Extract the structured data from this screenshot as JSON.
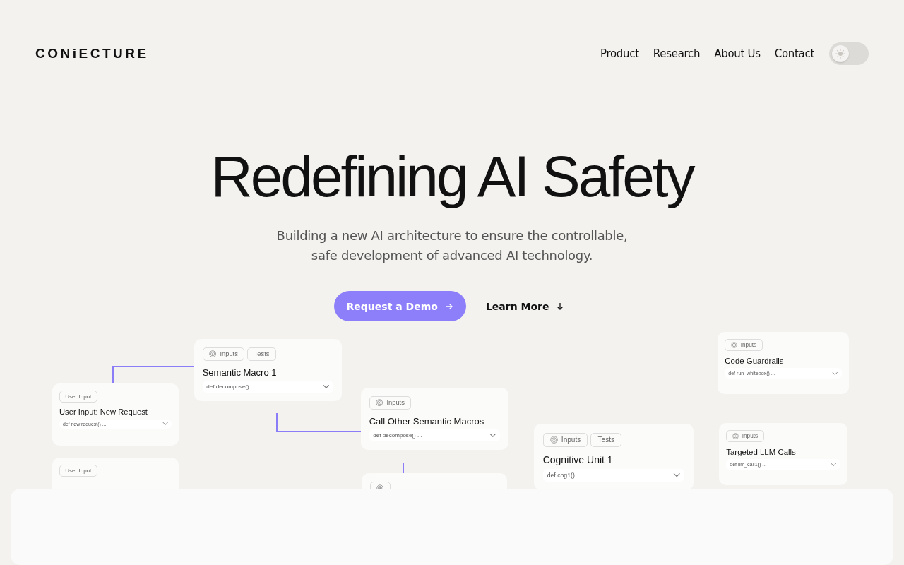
{
  "header": {
    "logo": "CONiECTURE",
    "nav": [
      "Product",
      "Research",
      "About Us",
      "Contact"
    ],
    "theme_toggle": {
      "on": false
    }
  },
  "hero": {
    "title": "Redefining AI Safety",
    "subtitle": [
      "Building a new AI architecture to ensure the controllable,",
      "safe development of advanced AI technology."
    ],
    "primary_button": "Request a Demo",
    "secondary_button": "Learn More"
  },
  "diagram": {
    "cards": [
      {
        "chips": [
          {
            "label": "User Input",
            "icon": false
          }
        ],
        "title": "User Input: New Request",
        "code": "def new request() ..."
      },
      {
        "chips": [
          {
            "label": "User Input",
            "icon": false
          }
        ]
      },
      {
        "chips": [
          {
            "label": "Inputs",
            "icon": true
          },
          {
            "label": "Tests",
            "icon": false
          }
        ],
        "title": "Semantic Macro 1",
        "code": "def decompose() ..."
      },
      {
        "chips": [
          {
            "label": "Inputs",
            "icon": true
          }
        ],
        "title": "Call Other Semantic Macros",
        "code": "def decompose() ..."
      },
      {
        "chips": [
          {
            "icon": true
          }
        ]
      },
      {
        "chips": [
          {
            "label": "Inputs",
            "icon": true
          },
          {
            "label": "Tests",
            "icon": false
          }
        ],
        "title": "Cognitive Unit 1",
        "code": "def cog1() ..."
      },
      {
        "chips": [
          {
            "label": "Inputs",
            "icon": true
          }
        ],
        "title": "Code Guardrails",
        "code": "def run_whitebox() ..."
      },
      {
        "chips": [
          {
            "label": "Inputs",
            "icon": true
          }
        ],
        "title": "Targeted LLM Calls",
        "code": "def llm_call1() ..."
      }
    ]
  }
}
